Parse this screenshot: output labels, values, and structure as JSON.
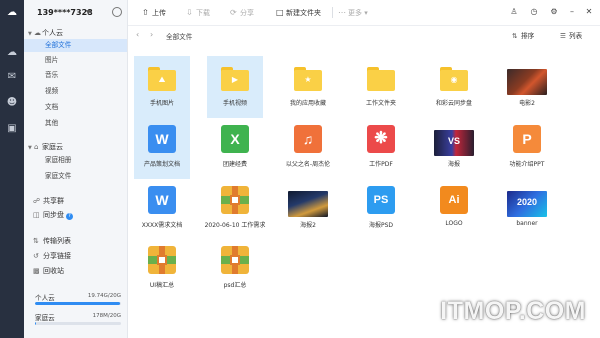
{
  "sidebar": {
    "account": "139****7328",
    "personal_cloud": {
      "title": "个人云",
      "items": [
        {
          "label": "全部文件"
        },
        {
          "label": "图片"
        },
        {
          "label": "音乐"
        },
        {
          "label": "视频"
        },
        {
          "label": "文档"
        },
        {
          "label": "其他"
        }
      ]
    },
    "family_cloud": {
      "title": "家庭云",
      "items": [
        {
          "label": "家庭相册"
        },
        {
          "label": "家庭文件"
        }
      ]
    },
    "tools": [
      {
        "label": "共享群"
      },
      {
        "label": "同步盘"
      }
    ],
    "tools2": [
      {
        "label": "传输列表"
      },
      {
        "label": "分享链接"
      },
      {
        "label": "回收站"
      }
    ],
    "quota": [
      {
        "label": "个人云",
        "value": "19.74G/20G",
        "fraction": 0.987
      },
      {
        "label": "家庭云",
        "value": "178M/20G",
        "fraction": 0.009
      }
    ]
  },
  "toolbar": {
    "upload": "上传",
    "download": "下载",
    "share": "分享",
    "new_folder": "新建文件夹",
    "more": "更多"
  },
  "nav": {
    "breadcrumb": "全部文件",
    "sort": "排序",
    "view": "列表"
  },
  "files": [
    {
      "name": "手机图片",
      "kind": "folder",
      "glyph": "image"
    },
    {
      "name": "手机视频",
      "kind": "folder",
      "glyph": "video"
    },
    {
      "name": "我的应用收藏",
      "kind": "folder",
      "glyph": "star"
    },
    {
      "name": "工作文件夹",
      "kind": "folder",
      "glyph": "none"
    },
    {
      "name": "和彩云同步盘",
      "kind": "folder",
      "glyph": "game"
    },
    {
      "name": "电影2",
      "kind": "image"
    },
    {
      "name": "产品策划文档",
      "kind": "word"
    },
    {
      "name": "团建经费",
      "kind": "excel"
    },
    {
      "name": "以父之名-周杰伦",
      "kind": "audio"
    },
    {
      "name": "工作PDF",
      "kind": "pdf"
    },
    {
      "name": "海报",
      "kind": "image",
      "thumb_text": "VS"
    },
    {
      "name": "功能介绍PPT",
      "kind": "ppt"
    },
    {
      "name": "XXXX需求文档",
      "kind": "word"
    },
    {
      "name": "2020-06-10 工作需求",
      "kind": "zip"
    },
    {
      "name": "海报2",
      "kind": "image"
    },
    {
      "name": "海报PSD",
      "kind": "psd"
    },
    {
      "name": "LOGO",
      "kind": "ai"
    },
    {
      "name": "banner",
      "kind": "image",
      "thumb_text": "2020"
    },
    {
      "name": "UI稿汇总",
      "kind": "zip"
    },
    {
      "name": "psd汇总",
      "kind": "zip"
    }
  ],
  "icon_letters": {
    "word": "W",
    "excel": "X",
    "ppt": "P",
    "psd": "PS",
    "ai": "Ai"
  },
  "watermark": "ITMOP.COM",
  "colors": {
    "accent": "#2f8cf2",
    "word": "#3a8ef0",
    "excel": "#3fb34f",
    "audio": "#f0713a",
    "pdf": "#ec4a4a",
    "ppt": "#f58a3a",
    "psd": "#2d9cf0",
    "ai": "#f28a1e",
    "folder": "#fad046"
  }
}
